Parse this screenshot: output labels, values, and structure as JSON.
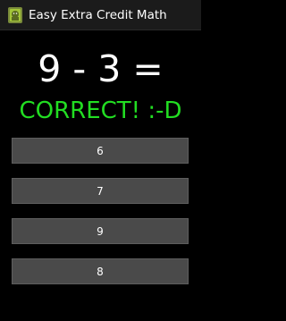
{
  "titlebar": {
    "icon": "android-icon",
    "title": "Easy Extra Credit Math"
  },
  "problem": {
    "text": "9 - 3 ="
  },
  "result": {
    "text": "CORRECT! :-D",
    "color": "#22dd22"
  },
  "answers": [
    {
      "label": "6"
    },
    {
      "label": "7"
    },
    {
      "label": "9"
    },
    {
      "label": "8"
    }
  ]
}
